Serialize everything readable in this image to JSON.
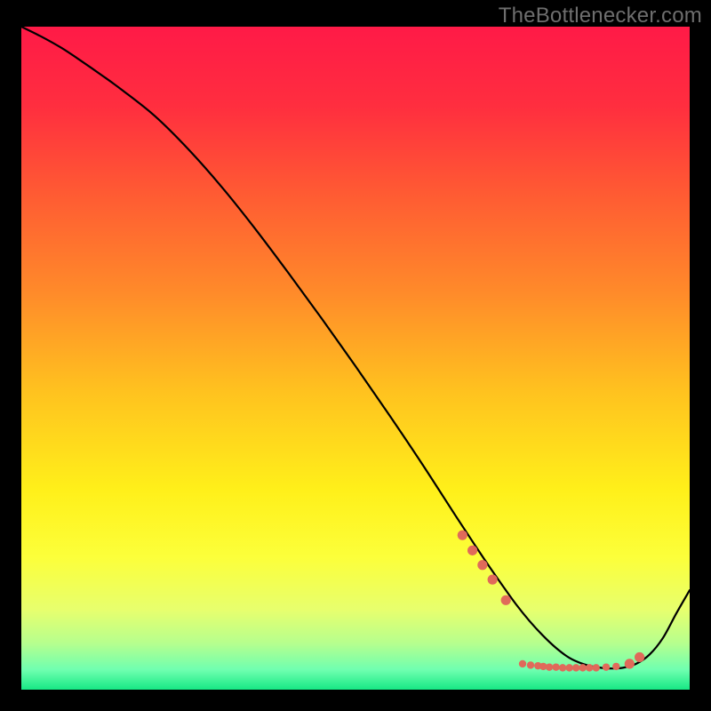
{
  "watermark": "TheBottlenecker.com",
  "chart_data": {
    "type": "line",
    "title": "",
    "xlabel": "",
    "ylabel": "",
    "xlim": [
      0,
      100
    ],
    "ylim": [
      0,
      100
    ],
    "background_gradient": {
      "stops": [
        {
          "offset": 0.0,
          "color": "#ff1a47"
        },
        {
          "offset": 0.12,
          "color": "#ff2e3f"
        },
        {
          "offset": 0.25,
          "color": "#ff5a33"
        },
        {
          "offset": 0.4,
          "color": "#ff8a2a"
        },
        {
          "offset": 0.55,
          "color": "#ffc21f"
        },
        {
          "offset": 0.7,
          "color": "#fff01a"
        },
        {
          "offset": 0.8,
          "color": "#fcff3a"
        },
        {
          "offset": 0.88,
          "color": "#e7ff6e"
        },
        {
          "offset": 0.93,
          "color": "#b6ff8e"
        },
        {
          "offset": 0.97,
          "color": "#6fffb0"
        },
        {
          "offset": 1.0,
          "color": "#17e884"
        }
      ]
    },
    "series": [
      {
        "name": "bottleneck-curve",
        "color": "#000000",
        "width": 2.2,
        "x": [
          0,
          3,
          6,
          9,
          12,
          15,
          20,
          25,
          30,
          35,
          40,
          45,
          50,
          55,
          60,
          65,
          68,
          70,
          72,
          74,
          76,
          78,
          80,
          82,
          84,
          86,
          88,
          90,
          92,
          94,
          96,
          98,
          100
        ],
        "y": [
          100,
          98.5,
          96.8,
          94.8,
          92.7,
          90.5,
          86.5,
          81.5,
          75.8,
          69.5,
          62.8,
          55.9,
          48.8,
          41.5,
          34.0,
          26.2,
          21.6,
          18.6,
          15.7,
          12.9,
          10.4,
          8.2,
          6.3,
          4.8,
          3.9,
          3.4,
          3.2,
          3.3,
          3.9,
          5.3,
          7.8,
          11.5,
          15
        ]
      }
    ],
    "markers": {
      "name": "highlight-points",
      "color": "#e06a5a",
      "radius_small": 4.2,
      "radius_large": 5.6,
      "points": [
        {
          "x": 66.0,
          "y": 23.3,
          "r": "large"
        },
        {
          "x": 67.5,
          "y": 21.0,
          "r": "large"
        },
        {
          "x": 69.0,
          "y": 18.8,
          "r": "large"
        },
        {
          "x": 70.5,
          "y": 16.6,
          "r": "large"
        },
        {
          "x": 72.5,
          "y": 13.5,
          "r": "large"
        },
        {
          "x": 75.0,
          "y": 3.9,
          "r": "small"
        },
        {
          "x": 76.2,
          "y": 3.7,
          "r": "small"
        },
        {
          "x": 77.3,
          "y": 3.6,
          "r": "small"
        },
        {
          "x": 78.1,
          "y": 3.5,
          "r": "small"
        },
        {
          "x": 79.0,
          "y": 3.4,
          "r": "small"
        },
        {
          "x": 80.0,
          "y": 3.4,
          "r": "small"
        },
        {
          "x": 81.0,
          "y": 3.3,
          "r": "small"
        },
        {
          "x": 82.0,
          "y": 3.3,
          "r": "small"
        },
        {
          "x": 83.0,
          "y": 3.3,
          "r": "small"
        },
        {
          "x": 84.0,
          "y": 3.3,
          "r": "small"
        },
        {
          "x": 85.0,
          "y": 3.3,
          "r": "small"
        },
        {
          "x": 86.0,
          "y": 3.3,
          "r": "small"
        },
        {
          "x": 87.5,
          "y": 3.4,
          "r": "small"
        },
        {
          "x": 89.0,
          "y": 3.5,
          "r": "small"
        },
        {
          "x": 91.0,
          "y": 3.9,
          "r": "large"
        },
        {
          "x": 92.5,
          "y": 4.9,
          "r": "large"
        }
      ]
    }
  }
}
